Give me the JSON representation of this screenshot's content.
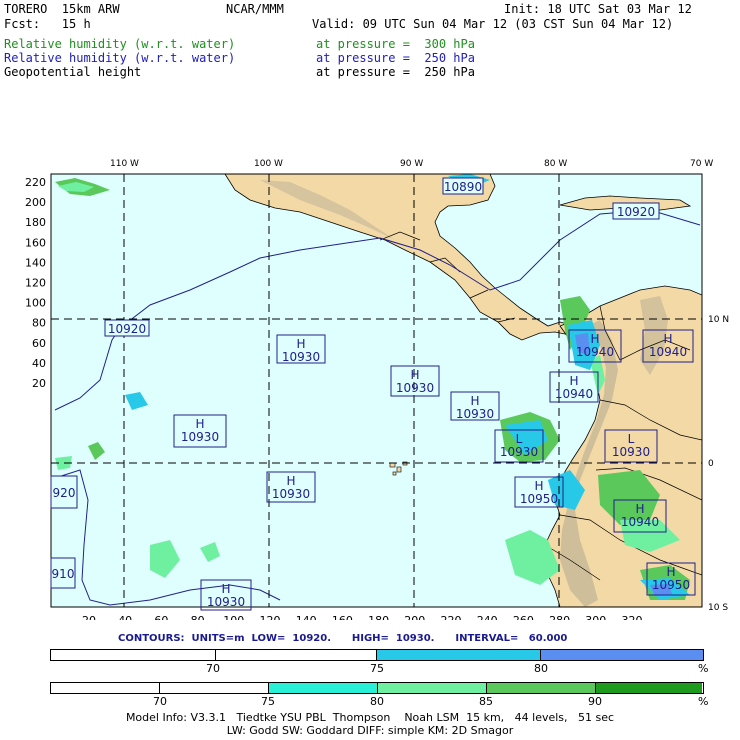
{
  "header": {
    "model": "TORERO  15km ARW",
    "center": "NCAR/MMM",
    "init": "Init: 18 UTC Sat 03 Mar 12",
    "fcst": "Fcst:   15 h",
    "valid": "Valid: 09 UTC Sun 04 Mar 12 (03 CST Sun 04 Mar 12)",
    "fields": [
      {
        "name": "Relative humidity (w.r.t. water)",
        "level": "at pressure =  300 hPa",
        "color": "#1f8f1f"
      },
      {
        "name": "Relative humidity (w.r.t. water)",
        "level": "at pressure =  250 hPa",
        "color": "#2020c0"
      },
      {
        "name": "Geopotential height",
        "level": "at pressure =  250 hPa",
        "color": "#000000"
      }
    ]
  },
  "map": {
    "top_lon_labels": [
      "110 W",
      "100 W",
      "90 W",
      "80 W",
      "70 W"
    ],
    "right_lat_labels": [
      "10 N",
      "0",
      "10 S"
    ],
    "left_y_labels": [
      "220",
      "200",
      "180",
      "160",
      "140",
      "120",
      "100",
      "80",
      "60",
      "40",
      "20"
    ],
    "bottom_x_labels": [
      "20",
      "40",
      "60",
      "80",
      "100",
      "120",
      "140",
      "160",
      "180",
      "200",
      "220",
      "240",
      "260",
      "280",
      "300",
      "320"
    ],
    "centers": [
      {
        "type": "H",
        "value": "10930"
      },
      {
        "type": "H",
        "value": "10930"
      },
      {
        "type": "H",
        "value": "10930"
      },
      {
        "type": "H",
        "value": "10930"
      },
      {
        "type": "H",
        "value": "10930"
      },
      {
        "type": "L",
        "value": "10930"
      },
      {
        "type": "L",
        "value": "10930"
      },
      {
        "type": "H",
        "value": "10940"
      },
      {
        "type": "H",
        "value": "10940"
      },
      {
        "type": "H",
        "value": "10940"
      },
      {
        "type": "H",
        "value": "10940"
      },
      {
        "type": "H",
        "value": "10950"
      },
      {
        "type": "H",
        "value": "10950"
      },
      {
        "type": "H",
        "value": "10930"
      }
    ],
    "contour_labels": [
      "10890",
      "10920",
      "10920",
      "920",
      "910"
    ],
    "colors": {
      "ocean": "#dfffff",
      "land": "#f2d9a6",
      "mountain": "#cbbb9c",
      "grid": "#000000",
      "contour": "#20208a"
    }
  },
  "contour_info": "CONTOURS:  UNITS=m  LOW=  10920.      HIGH=  10930.      INTERVAL=   60.000",
  "legend_blue": {
    "labels": [
      "70",
      "75",
      "80",
      "%"
    ],
    "colors": [
      "#ffffff",
      "#ffffff",
      "#28c8e8",
      "#5a8ef0"
    ]
  },
  "legend_green": {
    "labels": [
      "70",
      "75",
      "80",
      "85",
      "90",
      "%"
    ],
    "colors": [
      "#ffffff",
      "#ffffff",
      "#2af0d8",
      "#6ef0a0",
      "#5ac85a",
      "#1e9a1e"
    ]
  },
  "footer": {
    "line1": "Model Info: V3.3.1   Tiedtke YSU PBL  Thompson    Noah LSM  15 km,   44 levels,   51 sec",
    "line2": "LW: Godd SW: Goddard DIFF: simple KM: 2D Smagor"
  }
}
